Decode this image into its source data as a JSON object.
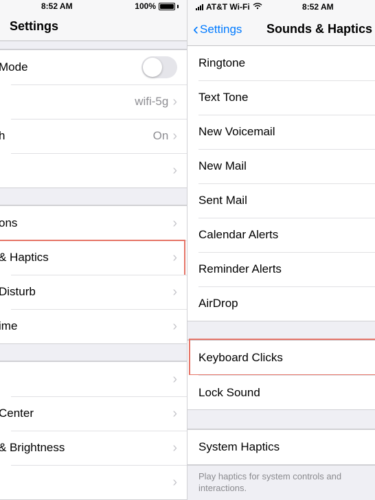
{
  "left": {
    "status": {
      "time": "8:52 AM",
      "battery_pct": "100%"
    },
    "nav": {
      "title": "Settings"
    },
    "group1": [
      {
        "label": "Mode",
        "detail": "",
        "toggle": true
      },
      {
        "label": "",
        "detail": "wifi-5g"
      },
      {
        "label": "h",
        "detail": "On"
      },
      {
        "label": "",
        "detail": ""
      }
    ],
    "group2": [
      {
        "label": "ons"
      },
      {
        "label": " & Haptics"
      },
      {
        "label": "Disturb"
      },
      {
        "label": "ime"
      }
    ],
    "group3": [
      {
        "label": ""
      },
      {
        "label": "Center"
      },
      {
        "label": " & Brightness"
      },
      {
        "label": ""
      }
    ]
  },
  "right": {
    "status": {
      "carrier": "AT&T Wi-Fi",
      "time": "8:52 AM"
    },
    "nav": {
      "back": "Settings",
      "title": "Sounds & Haptics"
    },
    "group1": [
      {
        "label": "Ringtone"
      },
      {
        "label": "Text Tone"
      },
      {
        "label": "New Voicemail"
      },
      {
        "label": "New Mail"
      },
      {
        "label": "Sent Mail"
      },
      {
        "label": "Calendar Alerts"
      },
      {
        "label": "Reminder Alerts"
      },
      {
        "label": "AirDrop"
      }
    ],
    "group2": [
      {
        "label": "Keyboard Clicks"
      },
      {
        "label": "Lock Sound"
      }
    ],
    "group3": [
      {
        "label": "System Haptics"
      }
    ],
    "footer": "Play haptics for system controls and interactions."
  },
  "highlights": {
    "left": {
      "row": " & Haptics"
    },
    "right": {
      "row": "Keyboard Clicks"
    }
  }
}
